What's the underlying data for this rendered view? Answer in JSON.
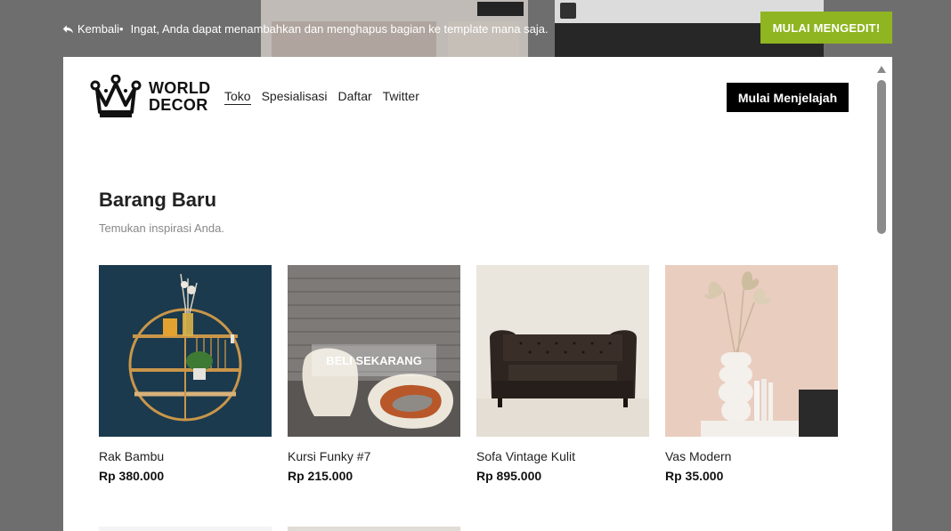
{
  "topbar": {
    "back_label": "Kembali",
    "hint_dot": "•",
    "hint_text": "Ingat, Anda dapat menambahkan dan menghapus bagian ke template mana saja.",
    "edit_button": "MULAI MENGEDIT!"
  },
  "site": {
    "logo_line1": "WORLD",
    "logo_line2": "DECOR",
    "nav": [
      "Toko",
      "Spesialisasi",
      "Daftar",
      "Twitter"
    ],
    "cta": "Mulai Menjelajah"
  },
  "section": {
    "title": "Barang Baru",
    "subtitle": "Temukan inspirasi Anda."
  },
  "products": [
    {
      "name": "Rak Bambu",
      "price": "Rp 380.000"
    },
    {
      "name": "Kursi Funky #7",
      "price": "Rp 215.000",
      "overlay": "BELI SEKARANG"
    },
    {
      "name": "Sofa Vintage Kulit",
      "price": "Rp 895.000"
    },
    {
      "name": "Vas Modern",
      "price": "Rp 35.000"
    }
  ],
  "colors": {
    "edit_button": "#8fb520",
    "overlay_bg": "#6e6e6e",
    "cta_bg": "#000000"
  }
}
